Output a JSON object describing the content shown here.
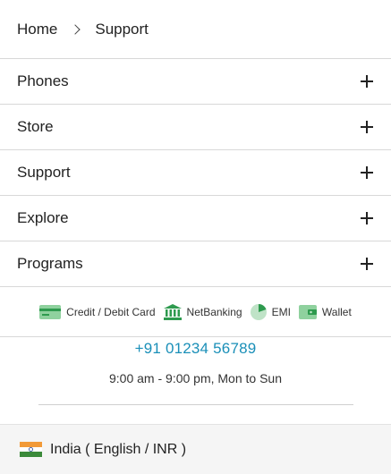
{
  "breadcrumb": {
    "home": "Home",
    "current": "Support"
  },
  "menu": {
    "items": [
      {
        "label": "Phones"
      },
      {
        "label": "Store"
      },
      {
        "label": "Support"
      },
      {
        "label": "Explore"
      },
      {
        "label": "Programs"
      }
    ]
  },
  "payments": {
    "card": "Credit / Debit Card",
    "netbanking": "NetBanking",
    "emi": "EMI",
    "wallet": "Wallet"
  },
  "contact": {
    "phone": "+91 01234 56789",
    "hours": "9:00 am - 9:00 pm, Mon to Sun"
  },
  "footer": {
    "region": "India ( English / INR )"
  },
  "colors": {
    "accent": "#1a8fb8",
    "icon_green": "#2e9a4e"
  }
}
